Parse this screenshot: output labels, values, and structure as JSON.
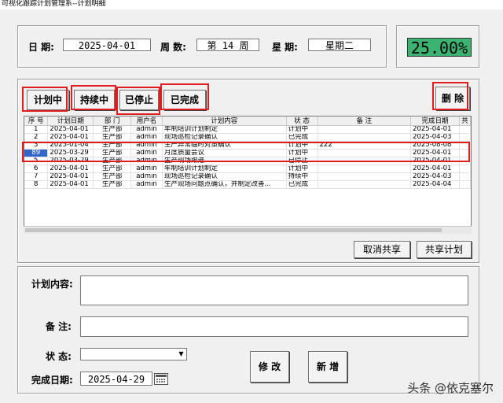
{
  "window": {
    "title": "可视化跟踪计划管理系--计划明细"
  },
  "header": {
    "date_label": "日  期:",
    "date_value": "2025-04-01",
    "week_label": "周  数:",
    "week_value": "第  14  周",
    "weekday_label": "星  期:",
    "weekday_value": "星期二",
    "percent": "25.00%"
  },
  "filters": {
    "planning": "计划中",
    "ongoing": "持续中",
    "stopped": "已停止",
    "done": "已完成",
    "delete": "删 除"
  },
  "table": {
    "columns": [
      "序 号",
      "计划日期",
      "部 门",
      "用户名",
      "计划内容",
      "状 态",
      "备 注",
      "完成日期",
      "共"
    ],
    "rows": [
      [
        "1",
        "2025-04-01",
        "生产部",
        "admin",
        "年制培训计划制定",
        "计划中",
        "",
        "2025-04-01"
      ],
      [
        "2",
        "2025-04-01",
        "生产部",
        "admin",
        "现场巡检记录确认",
        "已完成",
        "",
        "2025-04-03"
      ],
      [
        "3",
        "2025-01-04",
        "生产部",
        "admin",
        "生产异常临时对策确认",
        "计划中",
        "222",
        "2025-08-08"
      ],
      [
        "89",
        "2025-03-29",
        "生产部",
        "admin",
        "月度质量会议",
        "计划中",
        "",
        "2025-04-01"
      ],
      [
        "5",
        "2025-03-29",
        "生产部",
        "admin",
        "生产现场跟进",
        "已停止",
        "",
        "2025-04-01"
      ],
      [
        "6",
        "2025-04-01",
        "生产部",
        "admin",
        "年制培训计划制定",
        "计划中",
        "",
        "2025-04-01"
      ],
      [
        "7",
        "2025-04-01",
        "生产部",
        "admin",
        "现场巡检记录确认",
        "持续中",
        "",
        "2025-04-03"
      ],
      [
        "8",
        "2025-04-01",
        "生产部",
        "admin",
        "生产现场问题点确认，并制定改善...",
        "已完成",
        "",
        "2025-04-04"
      ]
    ]
  },
  "share": {
    "cancel": "取消共享",
    "share": "共享计划"
  },
  "form": {
    "content_label": "计划内容:",
    "remark_label": "备  注:",
    "status_label": "状  态:",
    "finish_label": "完成日期:",
    "finish_value": "2025-04-29",
    "modify": "修 改",
    "add": "新 增"
  },
  "watermark": "头条 @依克塞尔",
  "colors": {
    "percent_bg": "#3cb371",
    "highlight": "#e01e1e",
    "selection": "#3366cc"
  }
}
